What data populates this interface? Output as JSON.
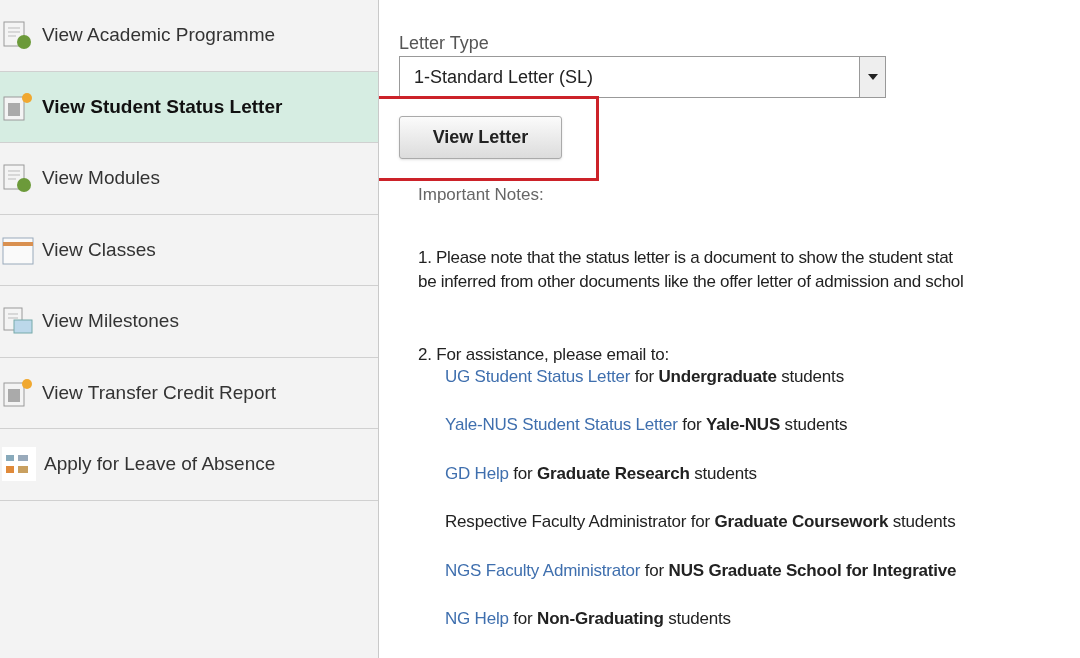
{
  "sidebar": {
    "items": [
      {
        "label": "View Academic Programme",
        "kind": "globe-doc",
        "selected": false
      },
      {
        "label": "View Student Status Letter",
        "kind": "dot-doc",
        "selected": true
      },
      {
        "label": "View Modules",
        "kind": "globe-doc",
        "selected": false
      },
      {
        "label": "View Classes",
        "kind": "calendar",
        "selected": false
      },
      {
        "label": "View Milestones",
        "kind": "stack-doc",
        "selected": false
      },
      {
        "label": "View Transfer Credit Report",
        "kind": "dot-doc",
        "selected": false
      },
      {
        "label": "Apply for Leave of Absence",
        "kind": "grid",
        "selected": false
      }
    ]
  },
  "form": {
    "letter_type": {
      "label": "Letter Type",
      "value": "1-Standard Letter (SL)"
    },
    "view_button": "View Letter",
    "notes_heading": "Important Notes:"
  },
  "note_1": [
    "1. Please note that the status letter is a document to show the student stat",
    "be inferred from other documents like the offer letter of admission and schol"
  ],
  "note_2": {
    "heading": "2. For assistance, please email to:",
    "contacts": [
      {
        "link": "UG Student Status Letter",
        "text": "for **Undergraduate** students"
      },
      {
        "link": "Yale-NUS Student Status Letter",
        "text": "for **Yale-NUS** students"
      },
      {
        "link": "GD Help",
        "text": "for **Graduate Research** students"
      },
      {
        "text": "Respective Faculty Administrator for **Graduate Coursework** students"
      },
      {
        "link": "NGS Faculty Administrator",
        "text": "for **NUS Graduate School for Integrative**"
      },
      {
        "link": "NG Help",
        "text": "for **Non-Graduating** students"
      }
    ]
  }
}
